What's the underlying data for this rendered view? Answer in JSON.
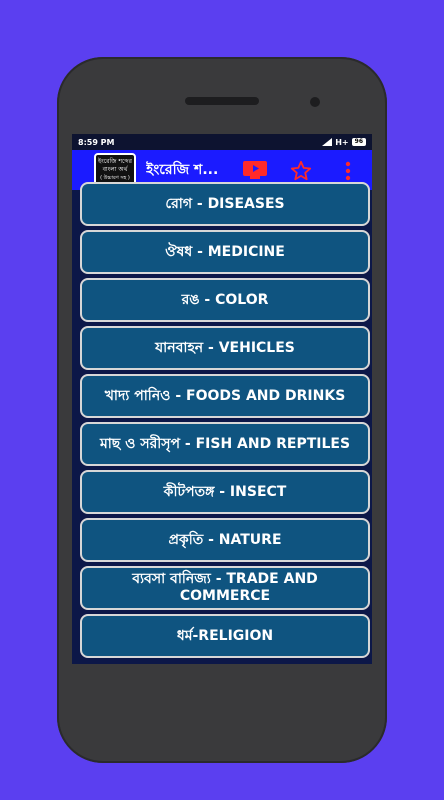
{
  "status": {
    "time": "8:59 PM",
    "network": "H+",
    "battery": "96"
  },
  "app": {
    "title": "ইংরেজি শ...",
    "logo_lines": [
      "ইংরেজি শব্দের",
      "বাংলা অর্থ",
      "( উচ্চারণ সহ )"
    ]
  },
  "icons": {
    "youtube": "youtube-icon",
    "star": "star-icon",
    "more": "more-vert-icon"
  },
  "colors": {
    "background": "#5b3ff0",
    "appbar": "#1b1bff",
    "item": "#0f5480",
    "star": "#ff2a2a"
  },
  "categories": [
    {
      "label": "রোগ - DISEASES"
    },
    {
      "label": "ঔষধ - MEDICINE"
    },
    {
      "label": "রঙ - COLOR"
    },
    {
      "label": "যানবাহন - VEHICLES"
    },
    {
      "label": "খাদ্য পানিও - FOODS AND DRINKS"
    },
    {
      "label": "মাছ ও সরীসৃপ - FISH AND REPTILES"
    },
    {
      "label": "কীটপতঙ্গ - INSECT"
    },
    {
      "label": "প্রকৃতি - NATURE"
    },
    {
      "label": "ব্যবসা বানিজ্য - TRADE AND COMMERCE"
    },
    {
      "label": "ধর্ম-RELIGION"
    }
  ]
}
